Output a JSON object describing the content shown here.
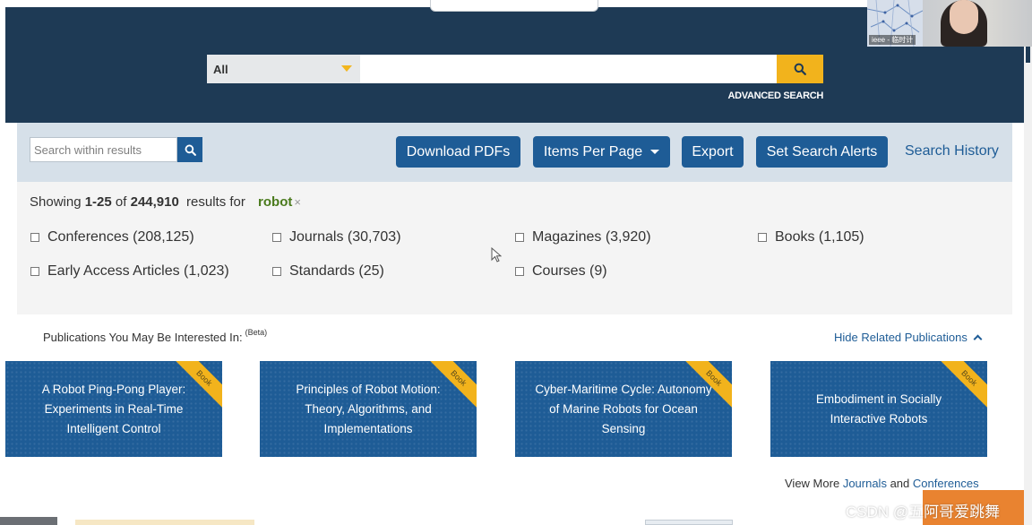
{
  "header": {
    "search_scope": "All",
    "search_value": "",
    "advanced_search": "ADVANCED SEARCH"
  },
  "webcam": {
    "name_label": "ieee - 临时计"
  },
  "toolbar": {
    "within_placeholder": "Search within results",
    "download_pdfs": "Download PDFs",
    "items_per_page": "Items Per Page",
    "export": "Export",
    "set_search_alerts": "Set Search Alerts",
    "search_history": "Search History"
  },
  "results": {
    "showing_label": "Showing",
    "range": "1-25",
    "of_label": "of",
    "total": "244,910",
    "results_for_label": "results for",
    "query": "robot",
    "query_clear": "×"
  },
  "facets": [
    {
      "label": "Conferences (208,125)"
    },
    {
      "label": "Journals (30,703)"
    },
    {
      "label": "Magazines (3,920)"
    },
    {
      "label": "Books (1,105)"
    },
    {
      "label": "Early Access Articles (1,023)"
    },
    {
      "label": "Standards (25)"
    },
    {
      "label": "Courses (9)"
    }
  ],
  "publications": {
    "title": "Publications You May Be Interested In:",
    "beta": "(Beta)",
    "hide_label": "Hide Related Publications",
    "cards": [
      {
        "title": "A Robot Ping-Pong Player: Experiments in Real-Time Intelligent Control",
        "badge": "Book"
      },
      {
        "title": "Principles of Robot Motion: Theory, Algorithms, and Implementations",
        "badge": "Book"
      },
      {
        "title": "Cyber-Maritime Cycle: Autonomy of Marine Robots for Ocean Sensing",
        "badge": "Book"
      },
      {
        "title": "Embodiment in Socially Interactive Robots",
        "badge": "Book"
      }
    ],
    "view_more_prefix": "View More",
    "journals_link": "Journals",
    "and_label": "and",
    "conferences_link": "Conferences"
  },
  "watermark": "CSDN @五阿哥爱跳舞",
  "colors": {
    "header_bg": "#1e3a55",
    "accent_yellow": "#f2b31c",
    "button_blue": "#1e5c96",
    "toolbar_bg": "#d6e0e9",
    "query_green": "#4a7a1c"
  }
}
